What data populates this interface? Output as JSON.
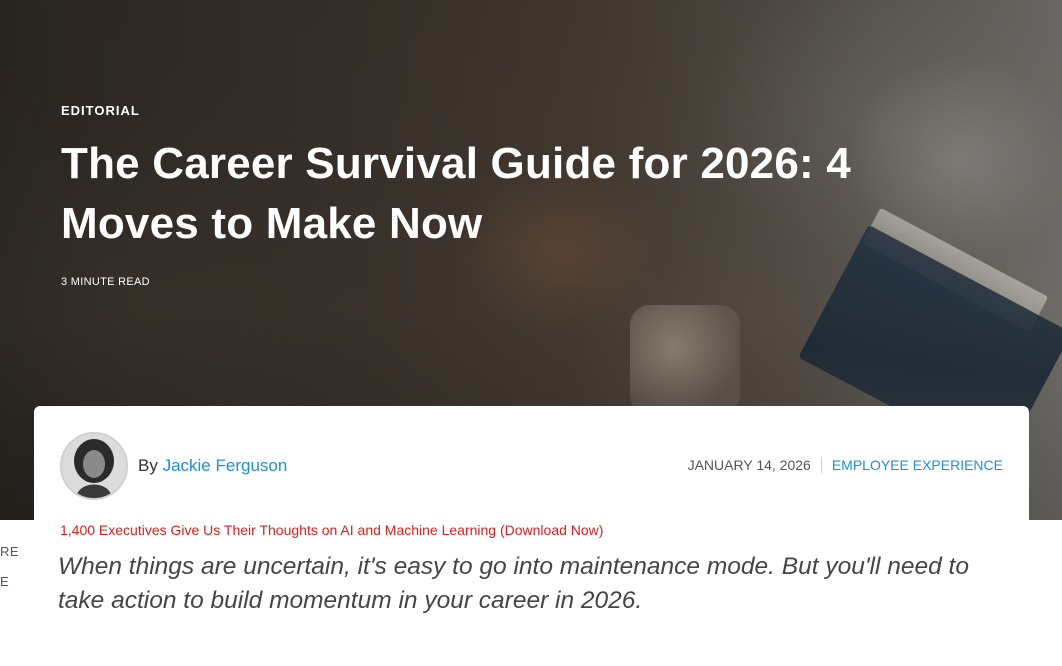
{
  "hero": {
    "eyebrow": "EDITORIAL",
    "title": "The Career Survival Guide for 2026: 4 Moves to Make Now",
    "read_time": "3 MINUTE READ"
  },
  "byline": {
    "prefix": "By",
    "author": "Jackie Ferguson"
  },
  "meta": {
    "date": "JANUARY 14, 2026",
    "category": "EMPLOYEE EXPERIENCE"
  },
  "promo": {
    "text": "1,400 Executives Give Us Their Thoughts on AI and Machine Learning",
    "link": "(Download Now)"
  },
  "lede": "When things are uncertain, it's easy to go into maintenance mode. But you'll need to take action to build momentum in your career in 2026.",
  "side_fragments": [
    "RE",
    "E"
  ],
  "colors": {
    "link_blue": "#1d8fe1",
    "promo_red": "#e21b1b"
  }
}
